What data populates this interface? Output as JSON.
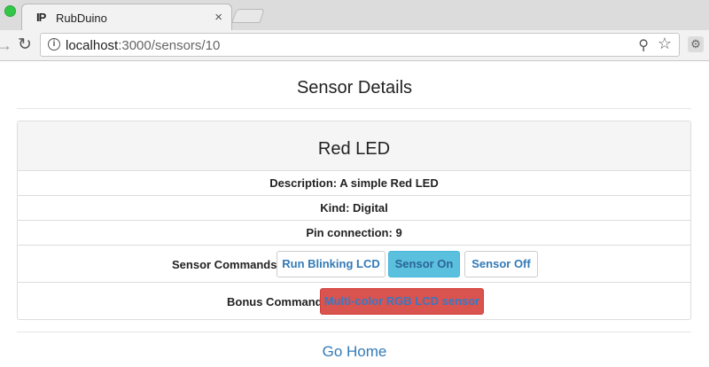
{
  "browser": {
    "tab_favicon": "IP",
    "tab_title": "RubDuino",
    "tab_close": "×",
    "url_host": "localhost",
    "url_path": ":3000/sensors/10"
  },
  "page": {
    "title": "Sensor Details",
    "sensor": {
      "name": "Red LED",
      "description": "Description: A simple Red LED",
      "kind": "Kind: Digital",
      "pin": "Pin connection: 9"
    },
    "commands": {
      "label": "Sensor Commands",
      "run_blinking": "Run Blinking LCD",
      "sensor_on": "Sensor On",
      "sensor_off": "Sensor Off"
    },
    "bonus": {
      "label": "Bonus Command",
      "rgb": "Multi-color RGB LCD sensor"
    },
    "go_home": "Go Home"
  },
  "colors": {
    "link": "#337ab7",
    "info": "#5bc0de",
    "danger": "#d9534f"
  }
}
